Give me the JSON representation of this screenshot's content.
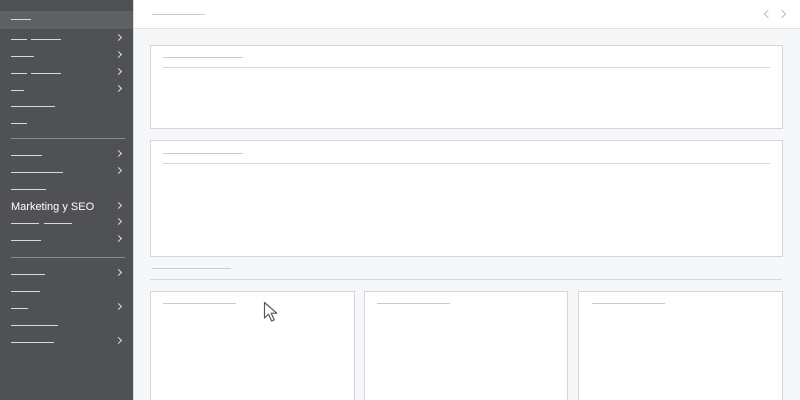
{
  "sidebar": {
    "active_item": "Marketing y SEO"
  }
}
